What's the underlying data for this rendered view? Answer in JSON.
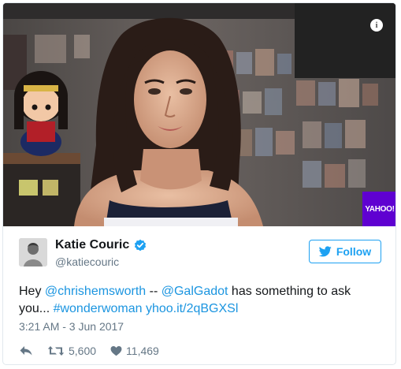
{
  "media": {
    "info_icon": "info-icon",
    "info_glyph": "i",
    "badge_text": "YAHOO!",
    "badge_color": "#5f01d1"
  },
  "author": {
    "name": "Katie Couric",
    "handle": "@katiecouric",
    "verified_icon": "verified-badge-icon"
  },
  "follow_button": {
    "label": "Follow",
    "icon": "twitter-bird-icon",
    "color": "#1da1f2"
  },
  "tweet": {
    "text_parts": [
      {
        "type": "text",
        "value": "Hey "
      },
      {
        "type": "link",
        "value": "@chrishemsworth"
      },
      {
        "type": "text",
        "value": " -- "
      },
      {
        "type": "link",
        "value": "@GalGadot"
      },
      {
        "type": "text",
        "value": " has something to ask you... "
      },
      {
        "type": "link",
        "value": "#wonderwoman"
      },
      {
        "type": "text",
        "value": " "
      },
      {
        "type": "link",
        "value": "yhoo.it/2qBGXSl"
      }
    ],
    "link_color": "#1b95e0",
    "timestamp": "3:21 AM - 3 Jun 2017"
  },
  "actions": {
    "reply_icon": "reply-icon",
    "retweet_icon": "retweet-icon",
    "retweet_count": "5,600",
    "like_icon": "heart-icon",
    "like_count": "11,469"
  }
}
